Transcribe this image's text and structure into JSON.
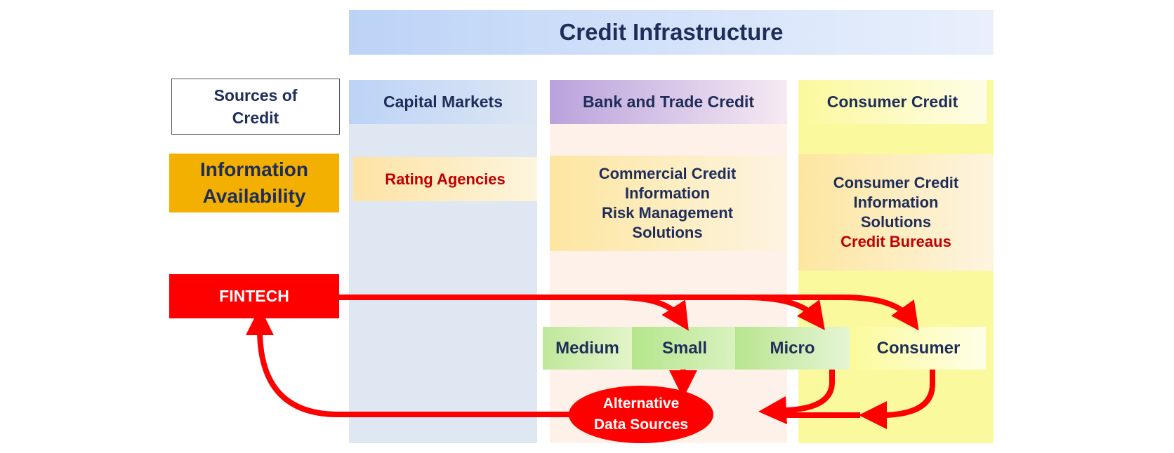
{
  "title": "Credit Infrastructure",
  "row_labels": {
    "sources": "Sources of Credit",
    "information_line1": "Information",
    "information_line2": "Availability",
    "fintech": "FINTECH"
  },
  "columns": {
    "capital_markets": {
      "header": "Capital Markets",
      "info": "Rating Agencies"
    },
    "bank_trade": {
      "header": "Bank and Trade Credit",
      "info_line1": "Commercial Credit",
      "info_line2": "Information",
      "info_line3": "Risk Management",
      "info_line4": "Solutions"
    },
    "consumer_credit": {
      "header": "Consumer Credit",
      "info_line1": "Consumer Credit",
      "info_line2": "Information",
      "info_line3": "Solutions",
      "info_line4": "Credit Bureaus"
    }
  },
  "segments": {
    "medium": "Medium",
    "small": "Small",
    "micro": "Micro",
    "consumer": "Consumer"
  },
  "alternative": {
    "line1": "Alternative",
    "line2": "Data Sources"
  },
  "colors": {
    "arrow_red": "#ff0000",
    "text_navy": "#1f2d5a",
    "text_dark_red": "#c00000",
    "info_orange": "#f3b000"
  }
}
